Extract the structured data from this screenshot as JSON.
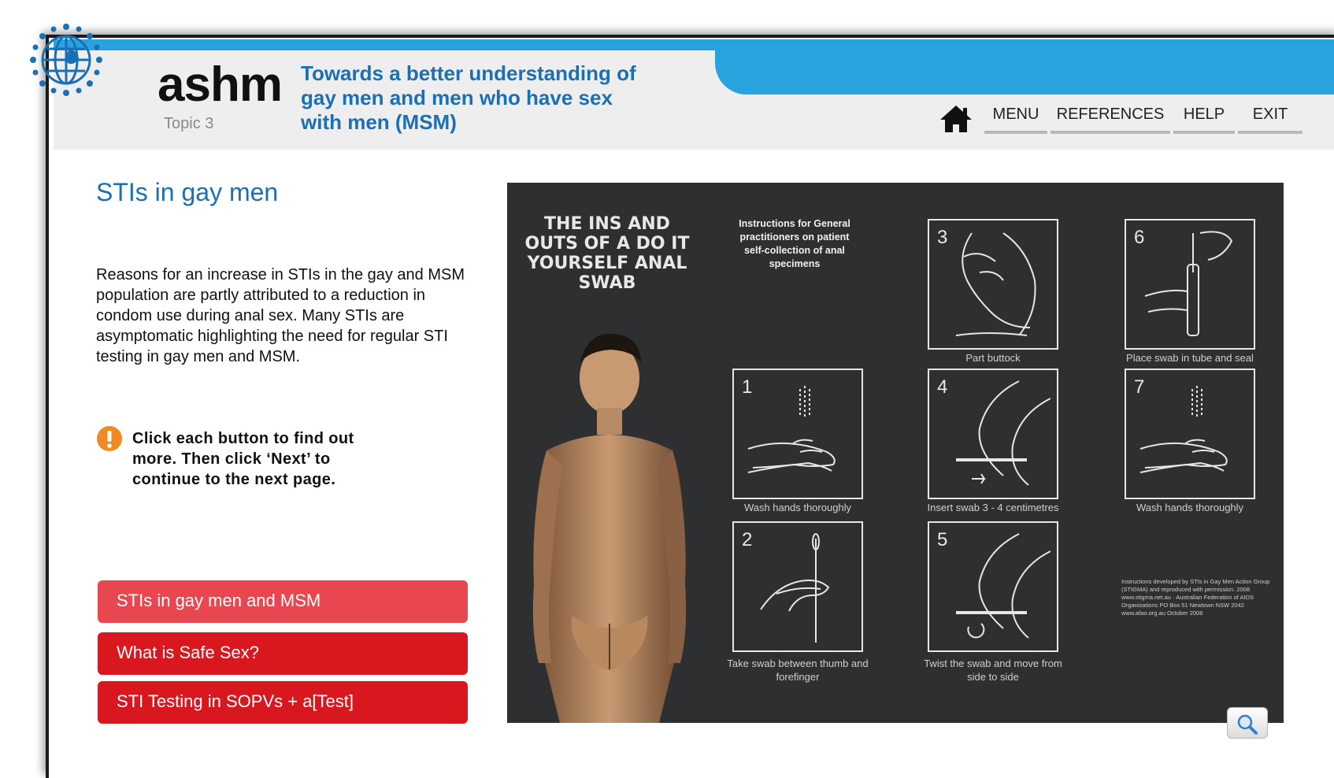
{
  "header": {
    "brand": "ashm",
    "topic": "Topic 3",
    "course_title": "Towards a better understanding of\ngay men and men who have sex\nwith men (MSM)",
    "nav": {
      "home_icon": "home-icon",
      "menu": "MENU",
      "references": "REFERENCES",
      "help": "HELP",
      "exit": "EXIT"
    }
  },
  "main": {
    "page_title": "STIs in gay men",
    "body": "Reasons for an increase in STIs in the gay and MSM population are partly attributed to a reduction in condom use during anal sex.  Many STIs are asymptomatic highlighting the need for regular STI testing in gay men and MSM.",
    "notice": "Click each button to find out more. Then click ‘Next’ to continue to the next page.",
    "buttons": [
      "STIs in gay men and MSM",
      "What is Safe Sex?",
      "STI Testing in SOPVs + a[Test]"
    ]
  },
  "poster": {
    "title": "THE INS AND OUTS OF A DO IT YOURSELF ANAL SWAB",
    "subtitle": "Instructions for General practitioners on patient self-collection of anal specimens",
    "steps": [
      {
        "num": "1",
        "caption": "Wash hands thoroughly"
      },
      {
        "num": "2",
        "caption": "Take swab between thumb and forefinger"
      },
      {
        "num": "3",
        "caption": "Part buttock"
      },
      {
        "num": "4",
        "caption": "Insert swab 3 - 4 centimetres"
      },
      {
        "num": "5",
        "caption": "Twist the swab and move from side to side"
      },
      {
        "num": "6",
        "caption": "Place swab in tube and seal"
      },
      {
        "num": "7",
        "caption": "Wash hands thoroughly"
      }
    ],
    "credits": "Instructions developed by STIs in Gay Men Action Group (STIGMA) and reproduced with permission. 2008 www.stigma.net.au · Australian Federation of AIDS Organisations PO Box 51 Newtown NSW 2042 www.afao.org.au October 2008"
  },
  "zoom_icon": "magnifier-icon",
  "colors": {
    "accent_blue": "#29a3dd",
    "title_blue": "#1a6fb5",
    "button_red": "#d9171f",
    "button_red_light": "#e84750",
    "notice_orange": "#f08a24",
    "poster_bg": "#2e2f31"
  }
}
